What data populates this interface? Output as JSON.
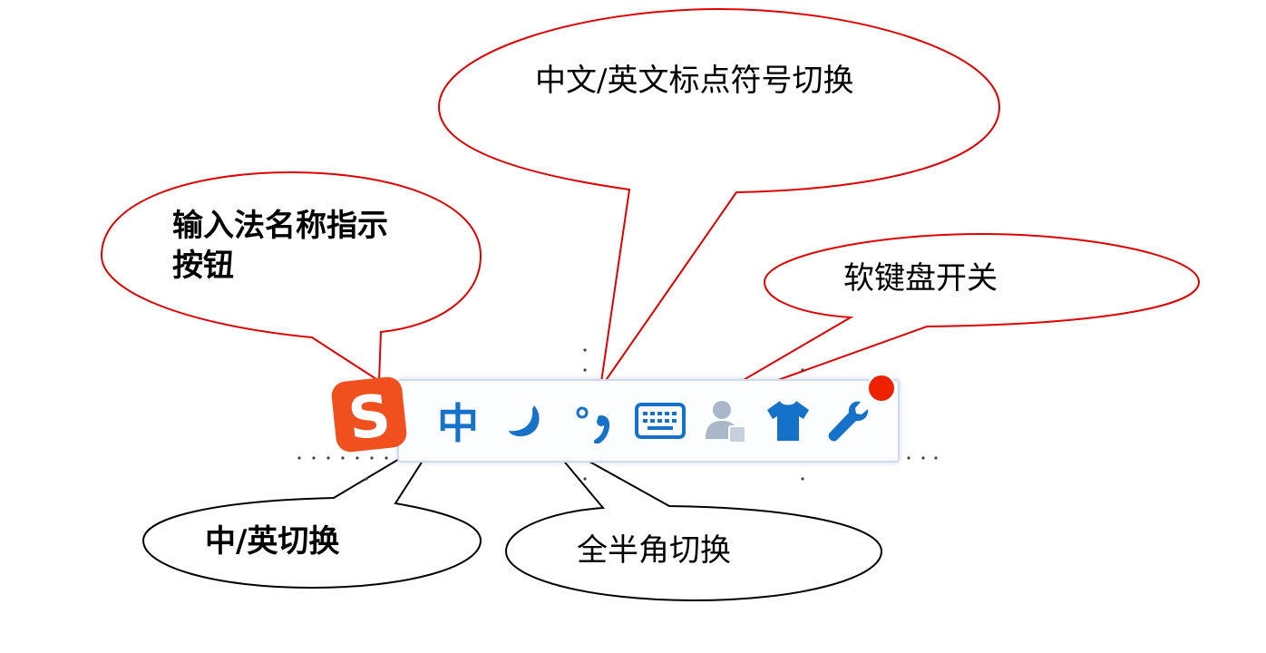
{
  "callouts": {
    "punct": "中文/英文标点符号切换",
    "ime_name_line1": "输入法名称指示",
    "ime_name_line2": "按钮",
    "keyboard": "软键盘开关",
    "lang": "中/英切换",
    "width": "全半角切换"
  },
  "toolbar": {
    "logo_letter": "S",
    "lang_label": "中",
    "punct_label": "°,",
    "icons": [
      "sogou-logo-icon",
      "moon-icon",
      "keyboard-icon",
      "user-icon",
      "shirt-icon",
      "wrench-icon"
    ]
  },
  "colors": {
    "callout_red": "#e00000",
    "callout_black": "#000000",
    "toolbar_blue": "#1671c9",
    "logo_orange": "#f0501e",
    "badge_red": "#ee2200"
  }
}
